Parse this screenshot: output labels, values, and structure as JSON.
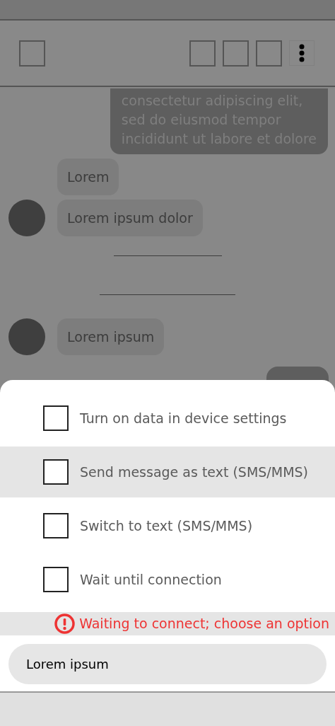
{
  "toolbar": {
    "left_buttons": [
      {
        "kind": "square"
      }
    ],
    "right_buttons": [
      {
        "kind": "square"
      },
      {
        "kind": "square"
      },
      {
        "kind": "square"
      },
      {
        "kind": "more"
      }
    ]
  },
  "messages": [
    {
      "kind": "outgoing",
      "lines": [
        "consectetur adipiscing elit,",
        "sed do eiusmod tempor",
        "incididunt ut labore et dolore"
      ]
    },
    {
      "kind": "incoming",
      "text": "Lorem",
      "avatar": false
    },
    {
      "kind": "incoming",
      "text": "Lorem ipsum dolor",
      "avatar": true
    },
    {
      "kind": "divider"
    },
    {
      "kind": "divider"
    },
    {
      "kind": "incoming",
      "text": "Lorem ipsum",
      "avatar": true
    }
  ],
  "options": [
    {
      "label": "Turn on data in device settings",
      "selected": false,
      "checked": false
    },
    {
      "label": "Send message as text (SMS/MMS)",
      "selected": true,
      "checked": false
    },
    {
      "label": "Switch to text (SMS/MMS)",
      "selected": false,
      "checked": false
    },
    {
      "label": "Wait until connection",
      "selected": false,
      "checked": false
    }
  ],
  "error": {
    "text": "Waiting to connect; choose an option"
  },
  "compose": {
    "value": "Lorem ipsum"
  }
}
